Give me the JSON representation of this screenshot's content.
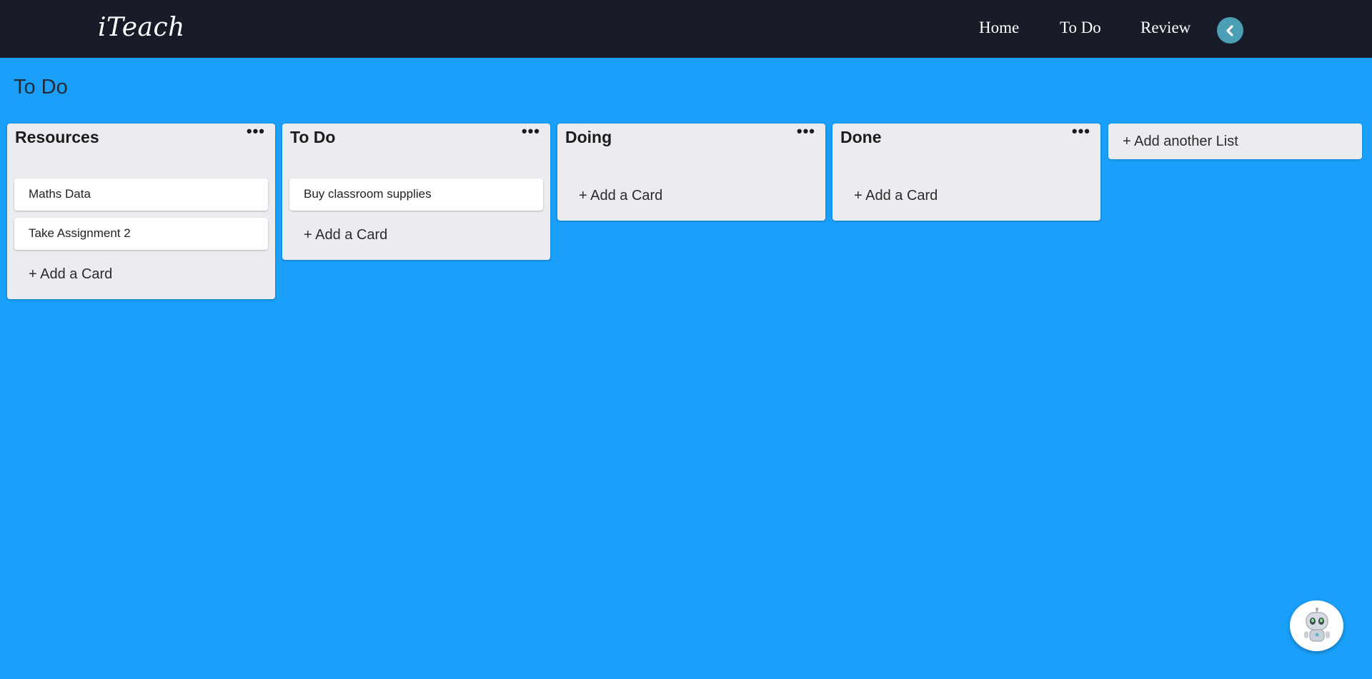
{
  "app": {
    "brand": "iTeach"
  },
  "nav": {
    "home": "Home",
    "todo": "To Do",
    "review": "Review"
  },
  "page": {
    "title": "To Do"
  },
  "lists": [
    {
      "title": "Resources",
      "cards": [
        "Maths Data",
        "Take Assignment 2"
      ],
      "add_card": "+ Add a Card"
    },
    {
      "title": "To Do",
      "cards": [
        "Buy classroom supplies"
      ],
      "add_card": "+ Add a Card"
    },
    {
      "title": "Doing",
      "cards": [],
      "add_card": "+ Add a Card"
    },
    {
      "title": "Done",
      "cards": [],
      "add_card": "+ Add a Card"
    }
  ],
  "add_list": "+ Add another List",
  "icons": {
    "back": "chevron-left-icon",
    "menu": "more-dots-icon",
    "assistant": "robot-icon"
  },
  "colors": {
    "background": "#1aa0fa",
    "topbar": "#181c29",
    "list": "#ebecf0",
    "back_button": "#4a9fb5"
  }
}
